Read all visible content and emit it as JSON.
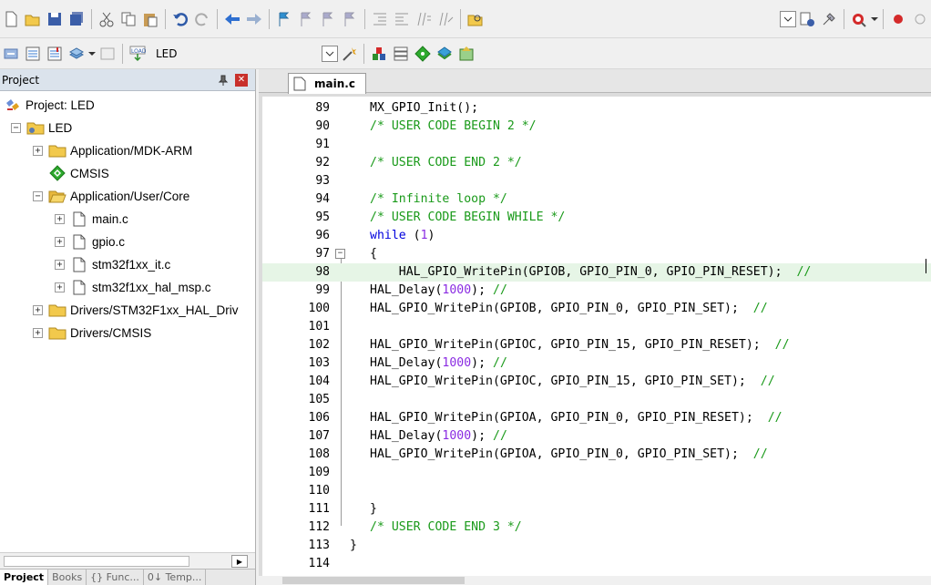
{
  "toolbar_top": {
    "icons": [
      "new-file-icon",
      "open-folder-icon",
      "save-icon",
      "save-all-icon",
      "cut-icon",
      "copy-icon",
      "paste-icon",
      "undo-icon",
      "redo-icon",
      "navigate-back-icon",
      "navigate-forward-icon",
      "bookmark-icon",
      "prev-bookmark-icon",
      "next-bookmark-icon",
      "clear-bookmarks-icon",
      "indent-icon",
      "unindent-icon",
      "comment-icon",
      "uncomment-icon",
      "find-in-files-icon",
      "target-dropdown-icon",
      "configure-icon",
      "debug-settings-icon",
      "start-debug-icon",
      "breakpoint-icon",
      "disable-breakpoint-icon"
    ]
  },
  "toolbar_build": {
    "target_name": "LED"
  },
  "project_panel": {
    "title": "Project",
    "tree": [
      {
        "label": "Project: LED",
        "level": 0,
        "icon": "project-icon",
        "expander": ""
      },
      {
        "label": "LED",
        "level": 1,
        "icon": "target-folder-icon",
        "expander": "−"
      },
      {
        "label": "Application/MDK-ARM",
        "level": 2,
        "icon": "folder-icon",
        "expander": "+"
      },
      {
        "label": "CMSIS",
        "level": 2,
        "icon": "cmsis-diamond-icon",
        "expander": ""
      },
      {
        "label": "Application/User/Core",
        "level": 2,
        "icon": "folder-open-icon",
        "expander": "−"
      },
      {
        "label": "main.c",
        "level": 3,
        "icon": "file-icon",
        "expander": "+"
      },
      {
        "label": "gpio.c",
        "level": 3,
        "icon": "file-icon",
        "expander": "+"
      },
      {
        "label": "stm32f1xx_it.c",
        "level": 3,
        "icon": "file-icon",
        "expander": "+"
      },
      {
        "label": "stm32f1xx_hal_msp.c",
        "level": 3,
        "icon": "file-icon",
        "expander": "+"
      },
      {
        "label": "Drivers/STM32F1xx_HAL_Driv",
        "level": 2,
        "icon": "folder-icon",
        "expander": "+"
      },
      {
        "label": "Drivers/CMSIS",
        "level": 2,
        "icon": "folder-icon",
        "expander": "+"
      }
    ],
    "bottom_tabs": [
      "Project",
      "Books",
      "{} Func...",
      "0↓ Temp..."
    ]
  },
  "editor": {
    "active_tab": "main.c",
    "lines": [
      {
        "n": "89",
        "code": "MX_GPIO_Init();",
        "type": "fn"
      },
      {
        "n": "90",
        "code": "/* USER CODE BEGIN 2 */",
        "type": "cm"
      },
      {
        "n": "91",
        "code": "",
        "type": "fn"
      },
      {
        "n": "92",
        "code": "/* USER CODE END 2 */",
        "type": "cm"
      },
      {
        "n": "93",
        "code": "",
        "type": "fn"
      },
      {
        "n": "94",
        "code": "/* Infinite loop */",
        "type": "cm"
      },
      {
        "n": "95",
        "code": "/* USER CODE BEGIN WHILE */",
        "type": "cm"
      },
      {
        "n": "96",
        "code": "while (1)",
        "type": "while"
      },
      {
        "n": "97",
        "code": "{",
        "type": "fn"
      },
      {
        "n": "98",
        "code": "    HAL_GPIO_WritePin(GPIOB, GPIO_PIN_0, GPIO_PIN_RESET);  //",
        "type": "fn"
      },
      {
        "n": "99",
        "code": "HAL_Delay(1000); //",
        "type": "delay"
      },
      {
        "n": "100",
        "code": "HAL_GPIO_WritePin(GPIOB, GPIO_PIN_0, GPIO_PIN_SET);  //",
        "type": "fn"
      },
      {
        "n": "101",
        "code": "",
        "type": "fn"
      },
      {
        "n": "102",
        "code": "HAL_GPIO_WritePin(GPIOC, GPIO_PIN_15, GPIO_PIN_RESET);  //",
        "type": "fn"
      },
      {
        "n": "103",
        "code": "HAL_Delay(1000); //",
        "type": "delay"
      },
      {
        "n": "104",
        "code": "HAL_GPIO_WritePin(GPIOC, GPIO_PIN_15, GPIO_PIN_SET);  //",
        "type": "fn"
      },
      {
        "n": "105",
        "code": "",
        "type": "fn"
      },
      {
        "n": "106",
        "code": "HAL_GPIO_WritePin(GPIOA, GPIO_PIN_0, GPIO_PIN_RESET);  //",
        "type": "fn"
      },
      {
        "n": "107",
        "code": "HAL_Delay(1000); //",
        "type": "delay"
      },
      {
        "n": "108",
        "code": "HAL_GPIO_WritePin(GPIOA, GPIO_PIN_0, GPIO_PIN_SET);  //",
        "type": "fn"
      },
      {
        "n": "109",
        "code": "",
        "type": "fn"
      },
      {
        "n": "110",
        "code": "",
        "type": "fn"
      },
      {
        "n": "111",
        "code": "}",
        "type": "fn"
      },
      {
        "n": "112",
        "code": "/* USER CODE END 3 */",
        "type": "cm"
      },
      {
        "n": "113",
        "code": "}",
        "type": "fn"
      },
      {
        "n": "114",
        "code": "",
        "type": "fn"
      }
    ],
    "highlight_line": "98",
    "colors": {
      "comment": "#1a9a1a",
      "keyword": "#0000dd",
      "number": "#8a2be2",
      "highlight": "#e6f5e6"
    }
  }
}
